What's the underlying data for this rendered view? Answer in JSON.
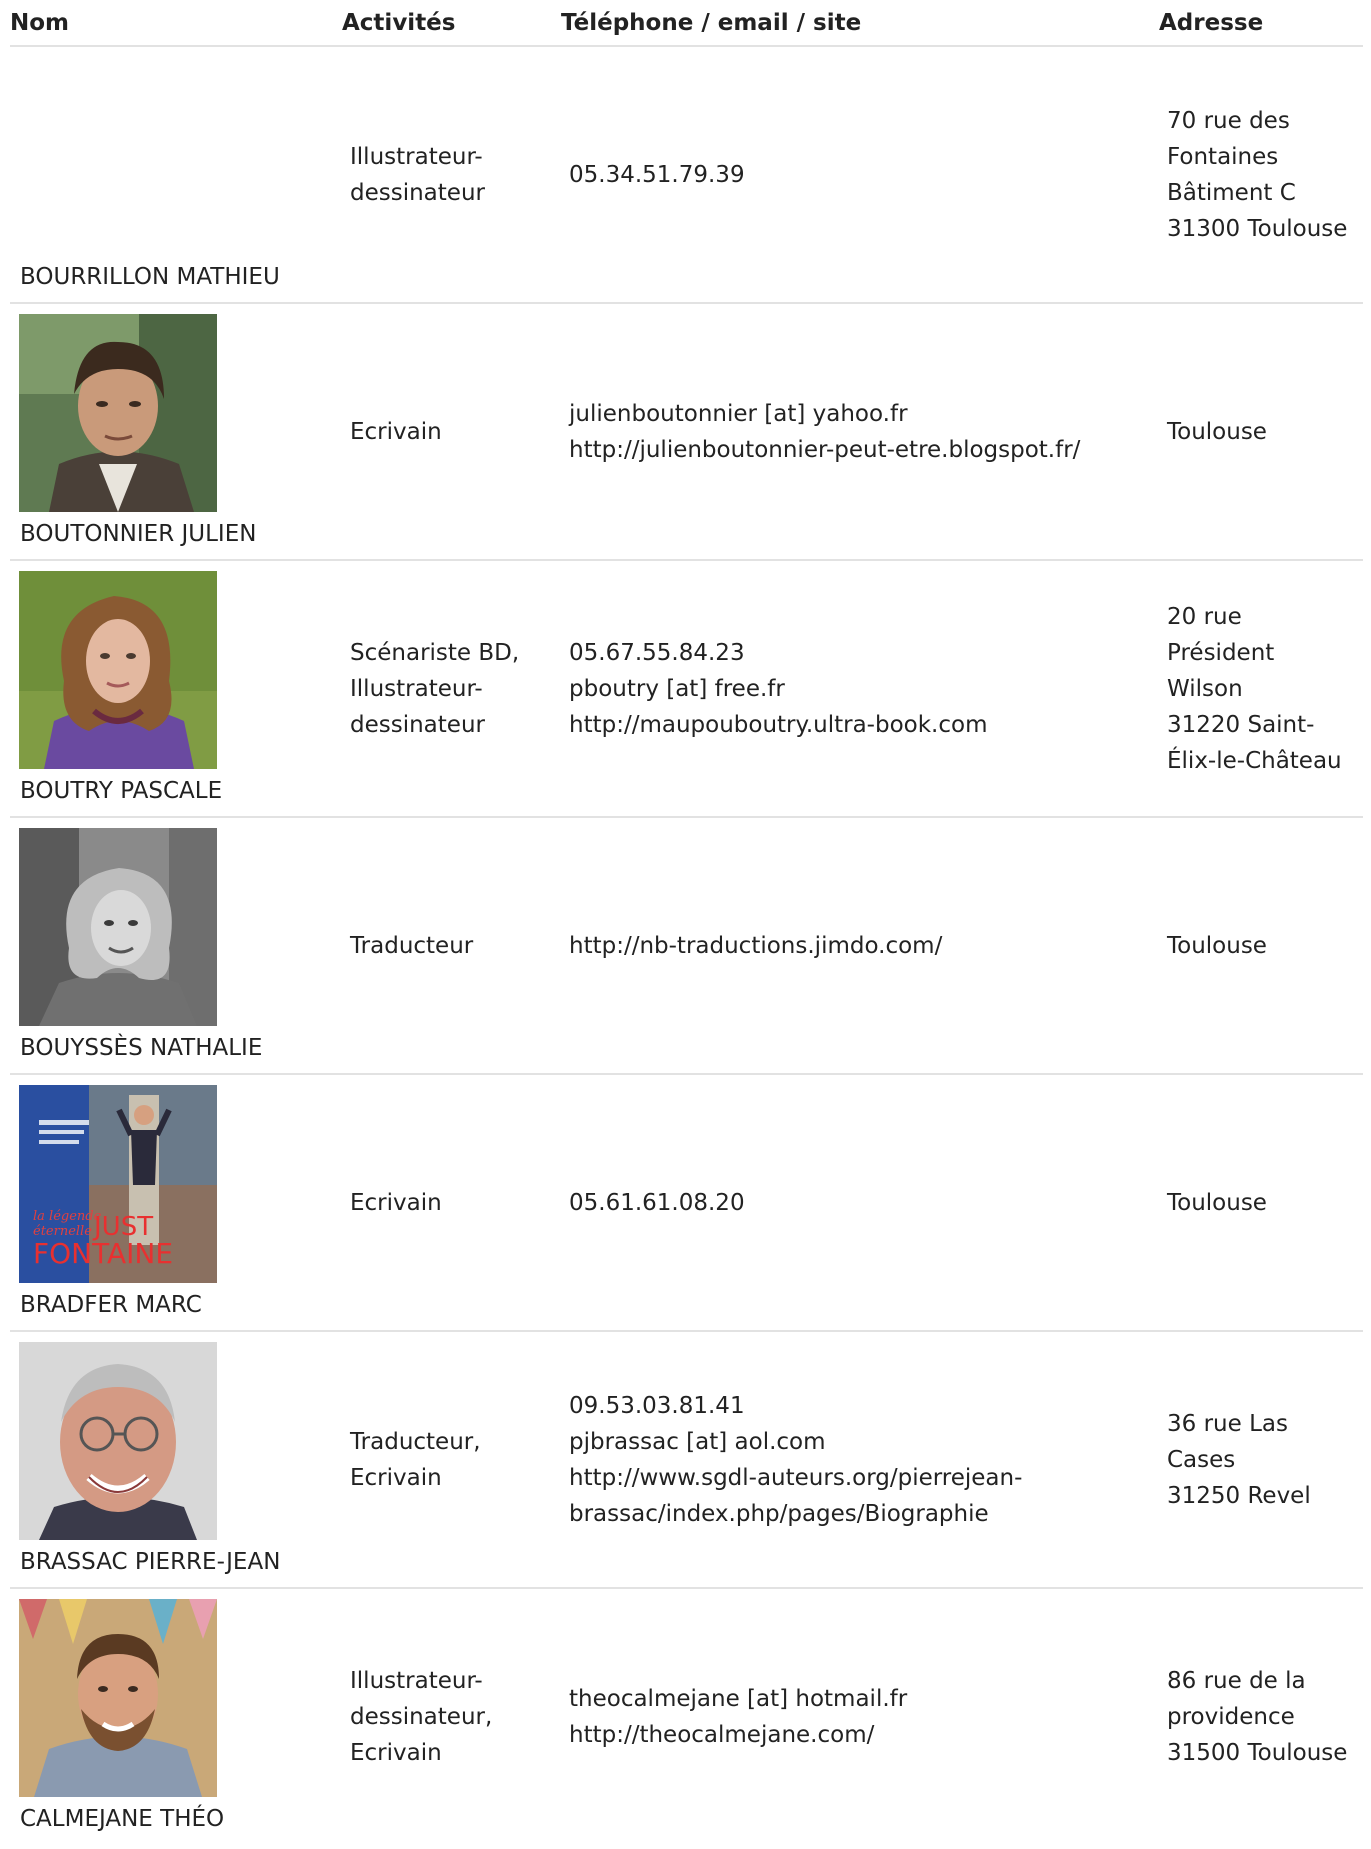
{
  "headers": {
    "nom": "Nom",
    "activites": "Activités",
    "contact": "Téléphone / email / site",
    "adresse": "Adresse"
  },
  "rows": [
    {
      "name": "BOURRILLON MATHIEU",
      "activities": [
        "Illustrateur-",
        "dessinateur"
      ],
      "contact": [
        "05.34.51.79.39"
      ],
      "address": [
        "70 rue des",
        "Fontaines",
        "Bâtiment C",
        "31300 Toulouse"
      ]
    },
    {
      "name": "BOUTONNIER JULIEN",
      "activities": [
        "Ecrivain"
      ],
      "contact": [
        "julienboutonnier [at] yahoo.fr",
        "http://julienboutonnier-peut-etre.blogspot.fr/"
      ],
      "address": [
        "Toulouse"
      ]
    },
    {
      "name": "BOUTRY PASCALE",
      "activities": [
        "Scénariste BD,",
        "Illustrateur-",
        "dessinateur"
      ],
      "contact": [
        "05.67.55.84.23",
        "pboutry [at] free.fr",
        "http://maupouboutry.ultra-book.com"
      ],
      "address": [
        "20 rue",
        "Président",
        "Wilson",
        "31220 Saint-",
        "Élix-le-Château"
      ]
    },
    {
      "name": "BOUYSSÈS NATHALIE",
      "activities": [
        "Traducteur"
      ],
      "contact": [
        "http://nb-traductions.jimdo.com/"
      ],
      "address": [
        "Toulouse"
      ]
    },
    {
      "name": "BRADFER MARC",
      "activities": [
        "Ecrivain"
      ],
      "contact": [
        "05.61.61.08.20"
      ],
      "address": [
        "Toulouse"
      ],
      "photo_text": {
        "l1": "la légende",
        "l2": "éternelle",
        "l3": "JUST",
        "l4": "FONTAINE"
      }
    },
    {
      "name": "BRASSAC PIERRE-JEAN",
      "activities": [
        "Traducteur,",
        "Ecrivain"
      ],
      "contact": [
        "09.53.03.81.41",
        "pjbrassac [at] aol.com",
        "http://www.sgdl-auteurs.org/pierrejean-",
        "brassac/index.php/pages/Biographie"
      ],
      "address": [
        "36 rue Las",
        "Cases",
        "31250 Revel"
      ]
    },
    {
      "name": "CALMEJANE THÉO",
      "activities": [
        "Illustrateur-",
        "dessinateur,",
        "Ecrivain"
      ],
      "contact": [
        "theocalmejane [at] hotmail.fr",
        "http://theocalmejane.com/"
      ],
      "address": [
        "86 rue de la",
        "providence",
        "31500 Toulouse"
      ]
    }
  ]
}
